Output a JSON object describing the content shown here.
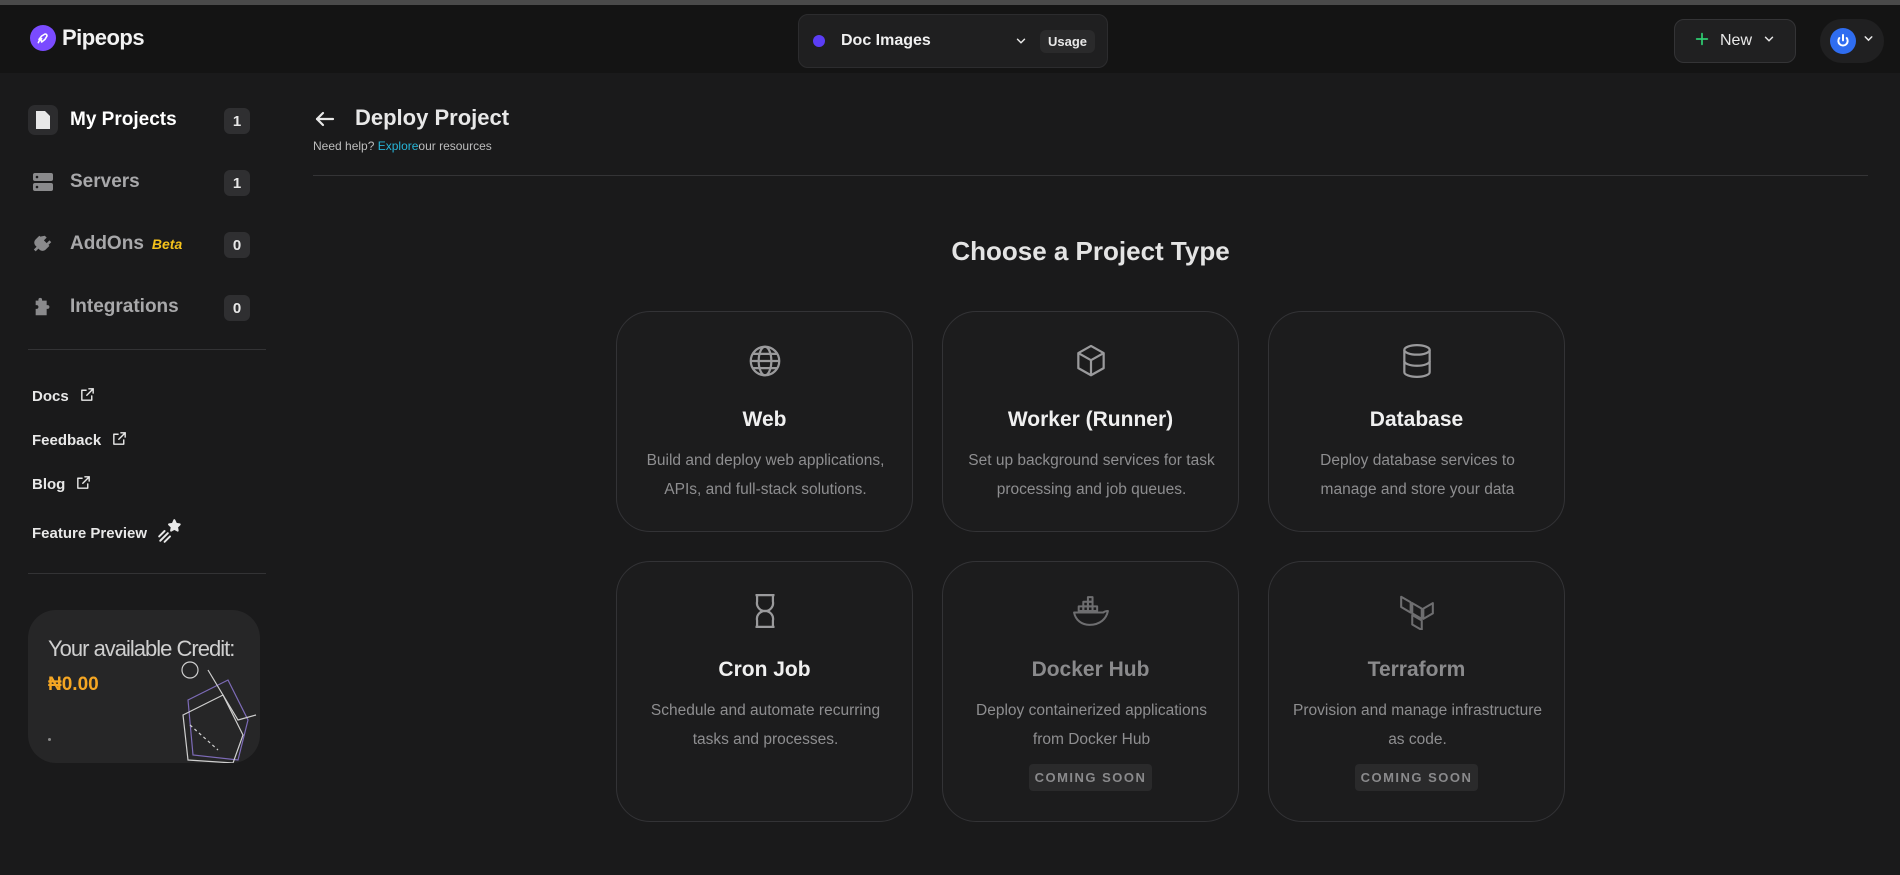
{
  "app": {
    "name": "Pipeops"
  },
  "header": {
    "project_name": "Doc Images",
    "usage_label": "Usage",
    "new_label": "New"
  },
  "sidebar": {
    "items": [
      {
        "label": "My Projects",
        "count": "1",
        "icon": "file-icon",
        "active": true
      },
      {
        "label": "Servers",
        "count": "1",
        "icon": "server-icon",
        "active": false
      },
      {
        "label": "AddOns",
        "badge": "Beta",
        "count": "0",
        "icon": "plug-icon",
        "active": false
      },
      {
        "label": "Integrations",
        "count": "0",
        "icon": "puzzle-icon",
        "active": false
      }
    ],
    "links": [
      {
        "label": "Docs",
        "icon": "external-link-icon"
      },
      {
        "label": "Feedback",
        "icon": "external-link-icon"
      },
      {
        "label": "Blog",
        "icon": "external-link-icon"
      },
      {
        "label": "Feature Preview",
        "icon": "sparkle-star-icon"
      }
    ],
    "credit": {
      "label": "Your available Credit:",
      "value": "₦0.00"
    }
  },
  "main": {
    "title": "Deploy Project",
    "help_prefix": "Need help? ",
    "help_link": "Explore",
    "help_suffix": "our resources",
    "section_title": "Choose a Project Type",
    "cards": [
      {
        "title": "Web",
        "desc": "Build and deploy web applications, APIs, and full-stack solutions.",
        "icon": "globe-icon"
      },
      {
        "title": "Worker (Runner)",
        "desc": "Set up background services for task processing and job queues.",
        "icon": "cube-icon"
      },
      {
        "title": "Database",
        "desc": "Deploy database services to manage and store your data",
        "icon": "database-icon"
      },
      {
        "title": "Cron Job",
        "desc": "Schedule and automate recurring tasks and processes.",
        "icon": "hourglass-icon"
      },
      {
        "title": "Docker Hub",
        "desc": "Deploy containerized applications from Docker Hub",
        "badge": "COMING SOON",
        "icon": "docker-icon"
      },
      {
        "title": "Terraform",
        "desc": "Provision and manage infrastructure as code.",
        "badge": "COMING SOON",
        "icon": "terraform-icon"
      }
    ]
  },
  "colors": {
    "background": "#1a1a1b",
    "accent_purple": "#5b3df5",
    "link_cyan": "#27b5d8",
    "credit_orange": "#f5a623",
    "beta_yellow": "#f5c21b"
  }
}
